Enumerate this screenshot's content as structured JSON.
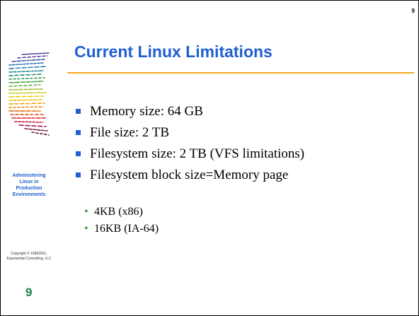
{
  "slide": {
    "page_number": "9",
    "title": "Current Linux Limitations",
    "course_title_lines": [
      "Administering",
      "Linux in",
      "Production",
      "Environments"
    ],
    "copyright_lines": [
      "Copyright © 19992001,",
      "Exponential Consulting, LLC"
    ],
    "bullets": [
      "Memory size: 64 GB",
      "File size: 2 TB",
      "Filesystem size: 2 TB (VFS limitations)",
      "Filesystem block size=Memory page"
    ],
    "sub_bullets": [
      "4KB (x86)",
      "16KB (IA-64)"
    ],
    "colors": {
      "title": "#1f5fd0",
      "rule": "#f2a81f",
      "bullet_marker": "#1f5fd0",
      "sub_marker": "#3c9a3c",
      "page_number": "#1b7f4b"
    },
    "logo_icon": "striped-colorful-logo-icon"
  }
}
